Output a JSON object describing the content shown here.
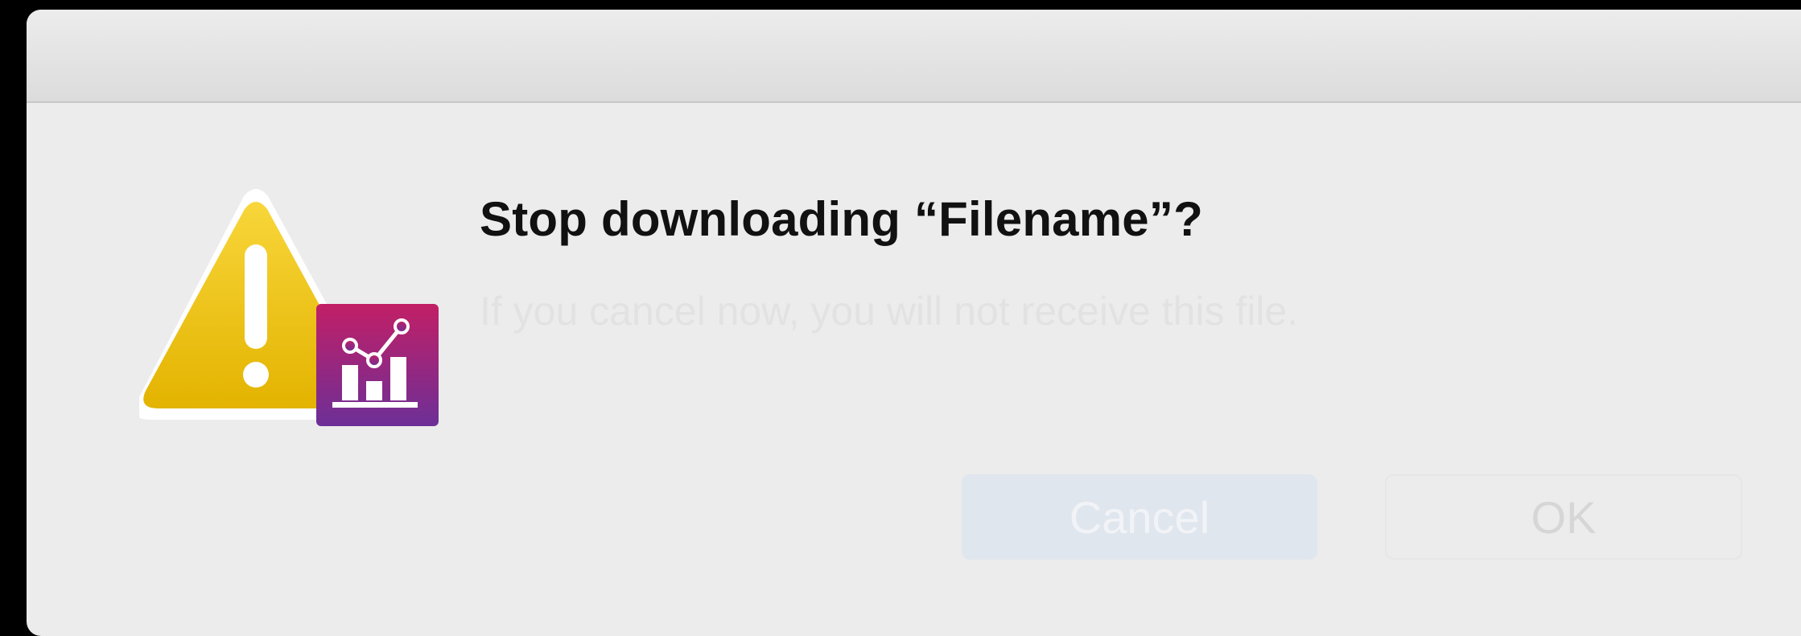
{
  "dialog": {
    "title": "Stop downloading “Filename”?",
    "message": "If you cancel now, you will not receive this file.",
    "buttons": {
      "cancel_label": "Cancel",
      "ok_label": "OK"
    },
    "icons": {
      "alert": "warning-triangle-icon",
      "app": "chart-app-icon"
    },
    "colors": {
      "warning_yellow": "#f2c400",
      "app_badge_magenta": "#b0206a",
      "app_badge_purple": "#6d2f97"
    }
  }
}
